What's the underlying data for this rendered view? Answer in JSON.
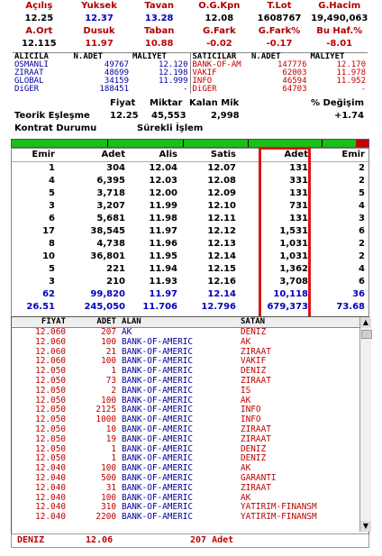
{
  "summary": {
    "row1_labels": [
      "Açılış",
      "Yuksek",
      "Tavan",
      "O.G.Kpn",
      "T.Lot",
      "G.Hacim"
    ],
    "row1_values": [
      "12.25",
      "12.37",
      "13.28",
      "12.08",
      "1608767",
      "19,490,063"
    ],
    "row2_labels": [
      "A.Ort",
      "Dusuk",
      "Taban",
      "G.Fark",
      "G.Fark%",
      "Bu Haf.%"
    ],
    "row2_values": [
      "12.115",
      "11.97",
      "10.88",
      "-0.02",
      "-0.17",
      "-8.01"
    ]
  },
  "brokers": {
    "headers": [
      "ALICILA",
      "N.ADET",
      "MALIYET",
      "SATICILAR",
      "N.ADET",
      "MALIYET"
    ],
    "rows": [
      [
        "OSMANLI",
        "49767",
        "12.120",
        "BANK-OF-AM",
        "147776",
        "12.170"
      ],
      [
        "ZIRAAT",
        "48699",
        "12.198",
        "VAKIF",
        "62003",
        "11.978"
      ],
      [
        "GLOBAL",
        "34159",
        "11.999",
        "INFO",
        "46594",
        "11.952"
      ],
      [
        "DiGER",
        "188451",
        "-",
        "DiGER",
        "64703",
        "-"
      ]
    ]
  },
  "order_info": {
    "head_fiyat": "Fiyat",
    "head_miktar": "Miktar",
    "head_kalan": "Kalan Mik",
    "head_degisim": "% Değişim",
    "teorik_label": "Teorik Eşleşme",
    "teorik_fiyat": "12.25",
    "teorik_miktar": "45,553",
    "teorik_kalan": "2,998",
    "teorik_degisim": "+1.74",
    "kontrat_label": "Kontrat Durumu",
    "kontrat_value": "Sürekli İşlem"
  },
  "depth": {
    "headers": [
      "Emir",
      "Adet",
      "Alis",
      "Satis",
      "Adet",
      "Emir"
    ],
    "rows": [
      [
        "1",
        "304",
        "12.04",
        "12.07",
        "131",
        "2"
      ],
      [
        "4",
        "6,395",
        "12.03",
        "12.08",
        "331",
        "2"
      ],
      [
        "5",
        "3,718",
        "12.00",
        "12.09",
        "131",
        "5"
      ],
      [
        "3",
        "3,207",
        "11.99",
        "12.10",
        "731",
        "4"
      ],
      [
        "6",
        "5,681",
        "11.98",
        "12.11",
        "131",
        "3"
      ],
      [
        "17",
        "38,545",
        "11.97",
        "12.12",
        "1,531",
        "6"
      ],
      [
        "8",
        "4,738",
        "11.96",
        "12.13",
        "1,031",
        "2"
      ],
      [
        "10",
        "36,801",
        "11.95",
        "12.14",
        "1,031",
        "2"
      ],
      [
        "5",
        "221",
        "11.94",
        "12.15",
        "1,362",
        "4"
      ],
      [
        "3",
        "210",
        "11.93",
        "12.16",
        "3,708",
        "6"
      ]
    ],
    "totals": [
      "62",
      "99,820",
      "11.97",
      "12.14",
      "10,118",
      "36"
    ],
    "averages": [
      "26.51",
      "245,050",
      "11.706",
      "12.796",
      "679,373",
      "73.68"
    ]
  },
  "trades": {
    "headers": [
      "FIYAT",
      "ADET",
      "ALAN",
      "SATAN"
    ],
    "rows": [
      [
        "12.060",
        "207",
        "AK",
        "DENIZ"
      ],
      [
        "12.060",
        "100",
        "BANK-OF-AMERIC",
        "AK"
      ],
      [
        "12.060",
        "21",
        "BANK-OF-AMERIC",
        "ZIRAAT"
      ],
      [
        "12.060",
        "100",
        "BANK-OF-AMERIC",
        "VAKIF"
      ],
      [
        "12.050",
        "1",
        "BANK-OF-AMERIC",
        "DENIZ"
      ],
      [
        "12.050",
        "73",
        "BANK-OF-AMERIC",
        "ZIRAAT"
      ],
      [
        "12.050",
        "2",
        "BANK-OF-AMERIC",
        "IS"
      ],
      [
        "12.050",
        "100",
        "BANK-OF-AMERIC",
        "AK"
      ],
      [
        "12.050",
        "2125",
        "BANK-OF-AMERIC",
        "INFO"
      ],
      [
        "12.050",
        "1000",
        "BANK-OF-AMERIC",
        "INFO"
      ],
      [
        "12.050",
        "10",
        "BANK-OF-AMERIC",
        "ZIRAAT"
      ],
      [
        "12.050",
        "19",
        "BANK-OF-AMERIC",
        "ZIRAAT"
      ],
      [
        "12.050",
        "1",
        "BANK-OF-AMERIC",
        "DENIZ"
      ],
      [
        "12.050",
        "1",
        "BANK-OF-AMERIC",
        "DENIZ"
      ],
      [
        "12.040",
        "100",
        "BANK-OF-AMERIC",
        "AK"
      ],
      [
        "12.040",
        "500",
        "BANK-OF-AMERIC",
        "GARANTI"
      ],
      [
        "12.040",
        "31",
        "BANK-OF-AMERIC",
        "ZIRAAT"
      ],
      [
        "12.040",
        "100",
        "BANK-OF-AMERIC",
        "AK"
      ],
      [
        "12.040",
        "310",
        "BANK-OF-AMERIC",
        "YATIRIM-FINANSM"
      ],
      [
        "12.040",
        "2200",
        "BANK-OF-AMERIC",
        "YATIRIM-FINANSM"
      ]
    ]
  },
  "bottom_bar": {
    "broker": "DENIZ",
    "price": "12.06",
    "qty": "207 Adet"
  },
  "colors": {
    "accent_red": "#c00000",
    "accent_blue": "#0000c0",
    "highlight_red": "#e01414",
    "bar_green": "#18c018"
  }
}
